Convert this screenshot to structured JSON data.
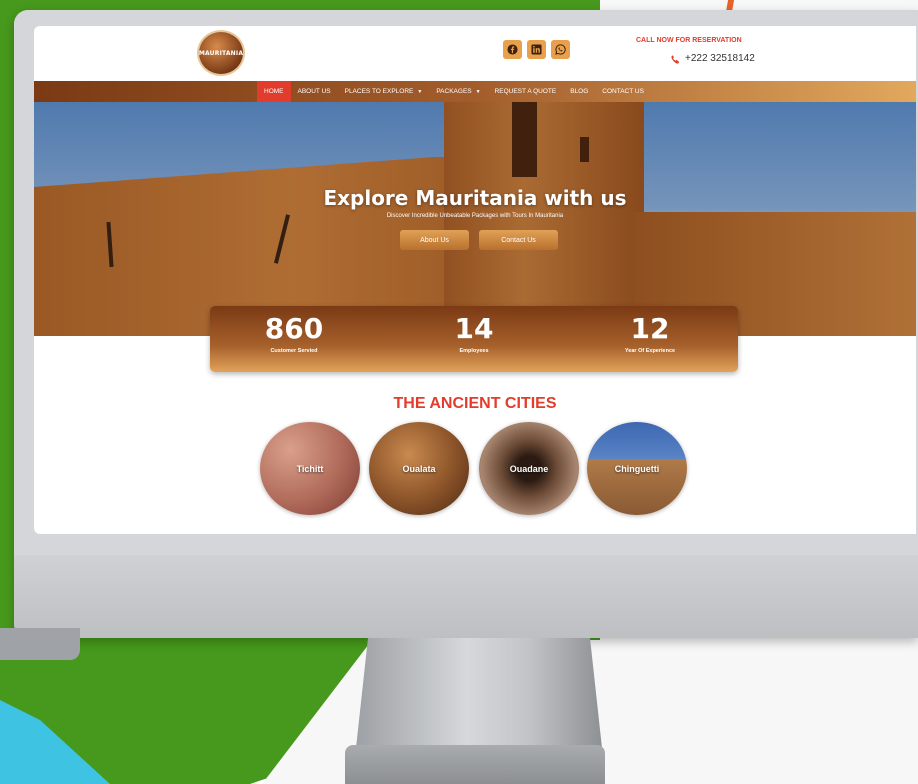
{
  "site": {
    "logo_text": "MAURITANIA",
    "socials": [
      "facebook-icon",
      "linkedin-icon",
      "whatsapp-icon"
    ],
    "call_label": "CALL NOW FOR RESERVATION",
    "phone": "+222 32518142"
  },
  "nav": {
    "items": [
      {
        "label": "HOME",
        "active": true
      },
      {
        "label": "ABOUT US"
      },
      {
        "label": "PLACES TO EXPLORE",
        "dropdown": true
      },
      {
        "label": "PACKAGES",
        "dropdown": true
      },
      {
        "label": "REQUEST A QUOTE"
      },
      {
        "label": "BLOG"
      },
      {
        "label": "CONTACT US"
      }
    ]
  },
  "hero": {
    "title": "Explore Mauritania with us",
    "subtitle": "Discover Incredible Unbeatable Packages with Tours In Mauritania",
    "btn_about": "About Us",
    "btn_contact": "Contact Us"
  },
  "stats": [
    {
      "value": "860",
      "label": "Customer Servied"
    },
    {
      "value": "14",
      "label": "Employees"
    },
    {
      "value": "12",
      "label": "Year Of Experience"
    }
  ],
  "cities": {
    "title": "THE ANCIENT CITIES",
    "items": [
      "Tichitt",
      "Oualata",
      "Ouadane",
      "Chinguetti"
    ]
  },
  "colors": {
    "accent_red": "#e23c2c",
    "brown_dark": "#7b3a14",
    "tan": "#e2a85d",
    "backdrop_green": "#46991c"
  }
}
